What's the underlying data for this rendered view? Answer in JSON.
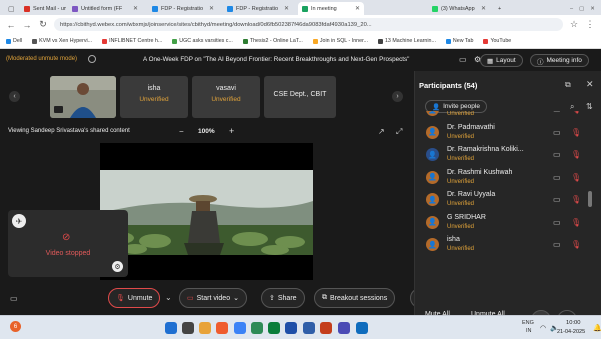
{
  "browser": {
    "tabs": [
      {
        "label": "Sent Mail - umar",
        "color": "#d93025"
      },
      {
        "label": "Untitled form (FF",
        "color": "#7e57c2"
      },
      {
        "label": "FDP - Registratio",
        "color": "#1e88e5"
      },
      {
        "label": "FDP - Registratio",
        "color": "#1e88e5"
      },
      {
        "label": "In meeting",
        "color": "#1aa260",
        "active": true
      },
      {
        "label": "(3) WhatsApp",
        "color": "#25d366"
      }
    ],
    "new_tab": "+",
    "url": "https://cbithyd.webex.com/wbxmjs/joinservice/sites/cbithyd/meeting/download/0d6fb502387f46da9083fdaf4930a139_20...",
    "bookmarks": [
      {
        "label": "Dell",
        "color": "#1e88e5"
      },
      {
        "label": "KVM vs Xen Hypervi...",
        "color": "#555"
      },
      {
        "label": "INFLIBNET Centre h...",
        "color": "#e53935"
      },
      {
        "label": "UGC asks varsities c...",
        "color": "#43a047"
      },
      {
        "label": "Thesis2 - Online LaT...",
        "color": "#2e7d32"
      },
      {
        "label": "Join in SQL - Inner...",
        "color": "#f9a825"
      },
      {
        "label": "13 Machine Learnin...",
        "color": "#424242"
      },
      {
        "label": "New Tab",
        "color": "#1e88e5"
      },
      {
        "label": "YouTube",
        "color": "#e53935"
      }
    ]
  },
  "meeting": {
    "mode_text": "(Moderated unmute mode)",
    "title": "A One-Week FDP on \"The AI Beyond Frontier: Recent Breakthroughs and Next-Gen Prospects\"",
    "layout_label": "Layout",
    "info_label": "Meeting info",
    "tiles": [
      {
        "name": "isha",
        "status": "Unverified"
      },
      {
        "name": "vasavi",
        "status": "Unverified"
      },
      {
        "name": "CSE Dept., CBIT",
        "status": ""
      }
    ],
    "share_text": "Viewing Sandeep Srivastava's shared content",
    "zoom": "100%",
    "zoom_minus": "−",
    "zoom_plus": "+",
    "video_stopped": "Video stopped"
  },
  "participants": {
    "title": "Participants (54)",
    "invite_label": "Invite people",
    "list": [
      {
        "name": "",
        "status": "Unverified",
        "initial": ""
      },
      {
        "name": "Dr. Padmavathi",
        "status": "Unverified",
        "initial": ""
      },
      {
        "name": "Dr. Ramakrishna Koliki...",
        "status": "Unverified",
        "initial": ""
      },
      {
        "name": "Dr. Rashmi Kushwah",
        "status": "Unverified",
        "initial": ""
      },
      {
        "name": "Dr. Ravi Uyyala",
        "status": "Unverified",
        "initial": ""
      },
      {
        "name": "G SRIDHAR",
        "status": "Unverified",
        "initial": ""
      },
      {
        "name": "isha",
        "status": "Unverified",
        "initial": ""
      }
    ],
    "mute_all": "Mute All",
    "unmute_all": "Unmute All"
  },
  "controls": {
    "unmute": "Unmute",
    "start_video": "Start video",
    "share": "Share",
    "breakout": "Breakout sessions",
    "more": "•••"
  },
  "taskbar": {
    "lang_top": "ENG",
    "lang_bottom": "IN",
    "time": "10:00",
    "date": "21-04-2025",
    "notification_count": "6"
  }
}
